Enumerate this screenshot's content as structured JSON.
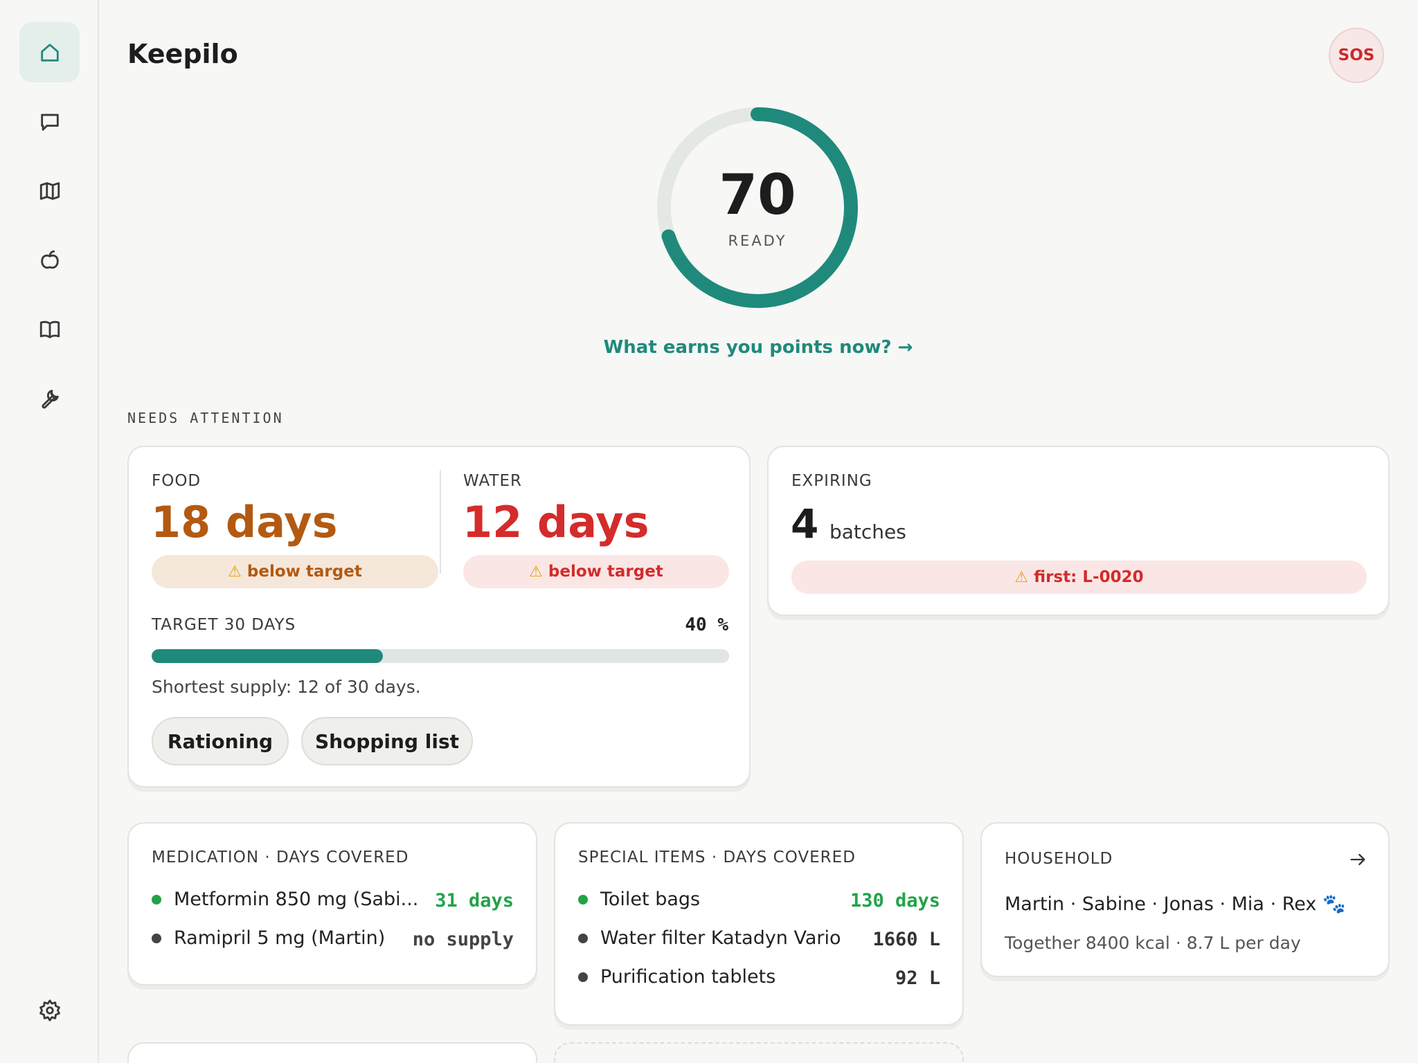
{
  "app": {
    "title": "Keepilo",
    "sos_label": "SOS"
  },
  "sidebar": {
    "items": [
      {
        "name": "home",
        "active": true
      },
      {
        "name": "chat",
        "active": false
      },
      {
        "name": "map",
        "active": false
      },
      {
        "name": "food",
        "active": false
      },
      {
        "name": "guide",
        "active": false
      },
      {
        "name": "tools",
        "active": false
      }
    ],
    "settings_icon": "gear-icon"
  },
  "readiness": {
    "score": "70",
    "score_value": 70,
    "label": "READY",
    "link_text": "What earns you points now? →"
  },
  "needs_attention": {
    "heading": "NEEDS ATTENTION",
    "food": {
      "label": "FOOD",
      "value": "18 days",
      "badge": "below target",
      "color": "#b35a12"
    },
    "water": {
      "label": "WATER",
      "value": "12 days",
      "badge": "below target",
      "color": "#d42b2b"
    },
    "target": {
      "label": "TARGET 30 DAYS",
      "percent_text": "40 %",
      "percent": 40,
      "note": "Shortest supply: 12 of 30 days."
    },
    "buttons": {
      "rationing": "Rationing",
      "shopping": "Shopping list"
    },
    "expiring": {
      "label": "EXPIRING",
      "count": "4",
      "unit": "batches",
      "badge": "first: L-0020"
    }
  },
  "medication": {
    "title": "MEDICATION · DAYS COVERED",
    "items": [
      {
        "name": "Metformin 850 mg (Sabi...",
        "value": "31 days",
        "status_color": "#22a34a",
        "value_color": "#22a34a"
      },
      {
        "name": "Ramipril 5 mg (Martin)",
        "value": "no supply",
        "status_color": "#444444",
        "value_color": "#444444"
      }
    ]
  },
  "special_items": {
    "title": "SPECIAL ITEMS · DAYS COVERED",
    "items": [
      {
        "name": "Toilet bags",
        "value": "130 days",
        "status_color": "#22a34a",
        "value_color": "#22a34a"
      },
      {
        "name": "Water filter Katadyn Vario",
        "value": "1660 L",
        "status_color": "#444444",
        "value_color": "#333333"
      },
      {
        "name": "Purification tablets",
        "value": "92 L",
        "status_color": "#444444",
        "value_color": "#333333"
      }
    ]
  },
  "household": {
    "title": "HOUSEHOLD",
    "members": "Martin · Sabine · Jonas · Mia · Rex 🐾",
    "summary": "Together 8400 kcal · 8.7 L per day"
  },
  "colors": {
    "accent": "#1f8a7c",
    "danger": "#d42b2b",
    "warning": "#b35a12",
    "ok": "#22a34a"
  }
}
